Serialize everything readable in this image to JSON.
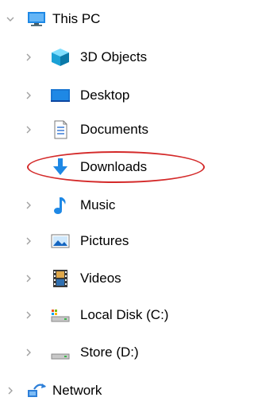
{
  "tree": {
    "root": {
      "label": "This PC",
      "expanded": true,
      "icon": "monitor-icon"
    },
    "items": [
      {
        "label": "3D Objects",
        "icon": "3d-objects-icon"
      },
      {
        "label": "Desktop",
        "icon": "desktop-folder-icon"
      },
      {
        "label": "Documents",
        "icon": "documents-icon"
      },
      {
        "label": "Downloads",
        "icon": "downloads-arrow-icon",
        "annotated": true,
        "annotation_color": "#d42a2a"
      },
      {
        "label": "Music",
        "icon": "music-note-icon"
      },
      {
        "label": "Pictures",
        "icon": "pictures-icon"
      },
      {
        "label": "Videos",
        "icon": "videos-icon"
      },
      {
        "label": "Local Disk (C:)",
        "icon": "local-disk-icon"
      },
      {
        "label": "Store (D:)",
        "icon": "drive-icon"
      }
    ],
    "network": {
      "label": "Network",
      "icon": "network-icon"
    }
  },
  "colors": {
    "accent_blue": "#1e88e5",
    "annotation_red": "#d42a2a",
    "chevron_gray": "#a0a0a0"
  }
}
